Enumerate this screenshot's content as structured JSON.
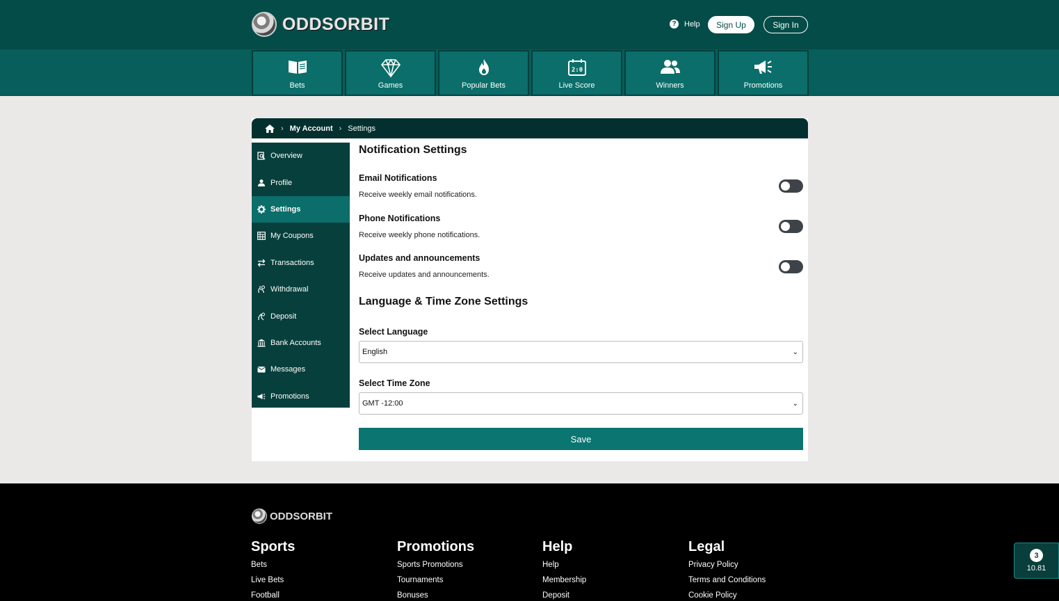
{
  "brand": {
    "name": "ODDSORBIT"
  },
  "header": {
    "help_label": "Help",
    "signup_label": "Sign Up",
    "signin_label": "Sign In"
  },
  "nav": [
    {
      "label": "Bets",
      "icon": "book-icon"
    },
    {
      "label": "Games",
      "icon": "diamond-icon"
    },
    {
      "label": "Popular Bets",
      "icon": "fire-icon"
    },
    {
      "label": "Live Score",
      "icon": "scoreboard-icon"
    },
    {
      "label": "Winners",
      "icon": "users-icon"
    },
    {
      "label": "Promotions",
      "icon": "megaphone-icon"
    }
  ],
  "breadcrumb": {
    "account": "My Account",
    "current": "Settings"
  },
  "sidebar": [
    {
      "label": "Overview",
      "icon": "search-doc-icon"
    },
    {
      "label": "Profile",
      "icon": "user-icon"
    },
    {
      "label": "Settings",
      "icon": "gear-icon",
      "active": true
    },
    {
      "label": "My Coupons",
      "icon": "table-icon"
    },
    {
      "label": "Transactions",
      "icon": "transfer-icon"
    },
    {
      "label": "Withdrawal",
      "icon": "hand-money-icon"
    },
    {
      "label": "Deposit",
      "icon": "hand-coin-icon"
    },
    {
      "label": "Bank Accounts",
      "icon": "bank-icon"
    },
    {
      "label": "Messages",
      "icon": "envelope-icon"
    },
    {
      "label": "Promotions",
      "icon": "megaphone-icon"
    }
  ],
  "notifications": {
    "title": "Notification Settings",
    "options": [
      {
        "title": "Email Notifications",
        "desc": "Receive weekly email notifications.",
        "enabled": false
      },
      {
        "title": "Phone Notifications",
        "desc": "Receive weekly phone notifications.",
        "enabled": false
      },
      {
        "title": "Updates and announcements",
        "desc": "Receive updates and announcements.",
        "enabled": false
      }
    ]
  },
  "language": {
    "title": "Language & Time Zone Settings",
    "lang_label": "Select Language",
    "lang_value": "English",
    "tz_label": "Select Time Zone",
    "tz_value": "GMT -12:00",
    "save_label": "Save"
  },
  "footer": {
    "columns": [
      {
        "title": "Sports",
        "links": [
          "Bets",
          "Live Bets",
          "Football"
        ]
      },
      {
        "title": "Promotions",
        "links": [
          "Sports Promotions",
          "Tournaments",
          "Bonuses"
        ]
      },
      {
        "title": "Help",
        "links": [
          "Help",
          "Membership",
          "Deposit"
        ]
      },
      {
        "title": "Legal",
        "links": [
          "Privacy Policy",
          "Terms and Conditions",
          "Cookie Policy"
        ]
      }
    ]
  },
  "betslip": {
    "count": "3",
    "odds": "10.81"
  }
}
